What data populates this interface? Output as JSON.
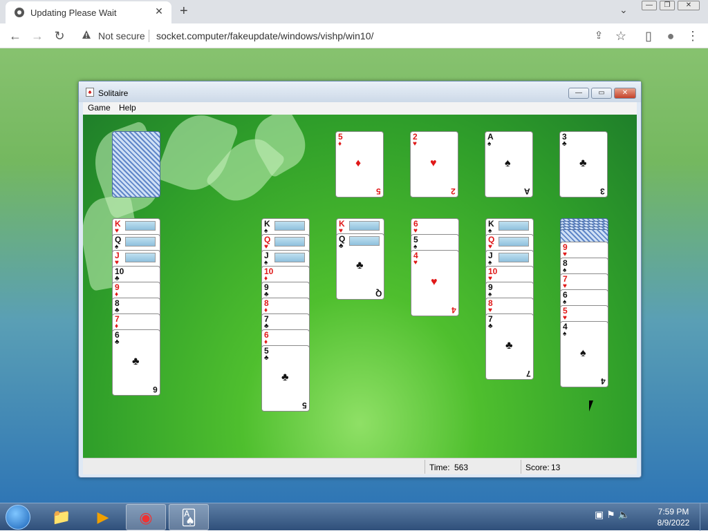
{
  "browser": {
    "tab_title": "Updating Please Wait",
    "tab_close": "✕",
    "new_tab": "+",
    "tab_menu": "⌄",
    "win_min": "—",
    "win_restore": "❐",
    "win_close": "✕",
    "back": "←",
    "forward": "→",
    "reload": "↻",
    "security_label": "Not secure",
    "url": "socket.computer/fakeupdate/windows/vishp/win10/",
    "share": "⇪",
    "star": "☆",
    "sidepanel": "▯",
    "profile": "●",
    "menu": "⋮"
  },
  "window": {
    "title": "Solitaire",
    "icon": "♠",
    "min": "—",
    "max": "▭",
    "close": "✕",
    "menus": [
      "Game",
      "Help"
    ]
  },
  "status": {
    "time_label": "Time:",
    "time_value": "563",
    "score_label": "Score:",
    "score_value": "13"
  },
  "taskbar": {
    "clock_time": "7:59 PM",
    "clock_date": "8/9/2022",
    "tray": "▣ ⚑ 🔈",
    "apps": [
      "📁",
      "▶",
      "◉",
      "🂡"
    ]
  },
  "cards": {
    "foundation": [
      {
        "rank": "5",
        "suit": "♦",
        "color": "red"
      },
      {
        "rank": "2",
        "suit": "♥",
        "color": "red"
      },
      {
        "rank": "A",
        "suit": "♠",
        "color": "blk"
      },
      {
        "rank": "3",
        "suit": "♣",
        "color": "blk"
      }
    ],
    "col1": [
      "K♥",
      "Q♠",
      "J♥",
      "10♣",
      "9♦",
      "8♣",
      "7♦",
      "6♣"
    ],
    "col3": [
      "K♠",
      "Q♥",
      "J♠",
      "10♦",
      "9♣",
      "8♦",
      "7♣",
      "6♦",
      "5♣"
    ],
    "col4": [
      "K♥",
      "Q♣"
    ],
    "col5": [
      "6♥",
      "5♠",
      "4♥"
    ],
    "col6": [
      "K♠",
      "Q♥",
      "J♠",
      "10♥",
      "9♠",
      "8♥",
      "7♣"
    ],
    "col7": [
      "9♥",
      "8♠",
      "7♥",
      "6♠",
      "5♥",
      "4♠"
    ]
  },
  "colors": {
    "felt": "#3aa82e",
    "titlebar": "#dfe9f5",
    "taskbar": "#2f4f7a"
  }
}
